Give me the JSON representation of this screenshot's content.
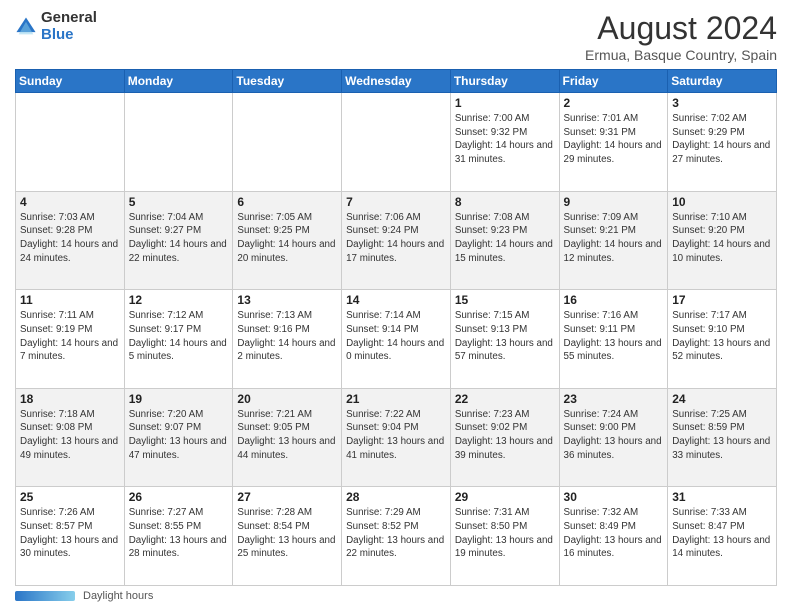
{
  "header": {
    "logo_general": "General",
    "logo_blue": "Blue",
    "month_year": "August 2024",
    "location": "Ermua, Basque Country, Spain"
  },
  "days_of_week": [
    "Sunday",
    "Monday",
    "Tuesday",
    "Wednesday",
    "Thursday",
    "Friday",
    "Saturday"
  ],
  "weeks": [
    [
      {
        "day": "",
        "info": ""
      },
      {
        "day": "",
        "info": ""
      },
      {
        "day": "",
        "info": ""
      },
      {
        "day": "",
        "info": ""
      },
      {
        "day": "1",
        "info": "Sunrise: 7:00 AM\nSunset: 9:32 PM\nDaylight: 14 hours and 31 minutes."
      },
      {
        "day": "2",
        "info": "Sunrise: 7:01 AM\nSunset: 9:31 PM\nDaylight: 14 hours and 29 minutes."
      },
      {
        "day": "3",
        "info": "Sunrise: 7:02 AM\nSunset: 9:29 PM\nDaylight: 14 hours and 27 minutes."
      }
    ],
    [
      {
        "day": "4",
        "info": "Sunrise: 7:03 AM\nSunset: 9:28 PM\nDaylight: 14 hours and 24 minutes."
      },
      {
        "day": "5",
        "info": "Sunrise: 7:04 AM\nSunset: 9:27 PM\nDaylight: 14 hours and 22 minutes."
      },
      {
        "day": "6",
        "info": "Sunrise: 7:05 AM\nSunset: 9:25 PM\nDaylight: 14 hours and 20 minutes."
      },
      {
        "day": "7",
        "info": "Sunrise: 7:06 AM\nSunset: 9:24 PM\nDaylight: 14 hours and 17 minutes."
      },
      {
        "day": "8",
        "info": "Sunrise: 7:08 AM\nSunset: 9:23 PM\nDaylight: 14 hours and 15 minutes."
      },
      {
        "day": "9",
        "info": "Sunrise: 7:09 AM\nSunset: 9:21 PM\nDaylight: 14 hours and 12 minutes."
      },
      {
        "day": "10",
        "info": "Sunrise: 7:10 AM\nSunset: 9:20 PM\nDaylight: 14 hours and 10 minutes."
      }
    ],
    [
      {
        "day": "11",
        "info": "Sunrise: 7:11 AM\nSunset: 9:19 PM\nDaylight: 14 hours and 7 minutes."
      },
      {
        "day": "12",
        "info": "Sunrise: 7:12 AM\nSunset: 9:17 PM\nDaylight: 14 hours and 5 minutes."
      },
      {
        "day": "13",
        "info": "Sunrise: 7:13 AM\nSunset: 9:16 PM\nDaylight: 14 hours and 2 minutes."
      },
      {
        "day": "14",
        "info": "Sunrise: 7:14 AM\nSunset: 9:14 PM\nDaylight: 14 hours and 0 minutes."
      },
      {
        "day": "15",
        "info": "Sunrise: 7:15 AM\nSunset: 9:13 PM\nDaylight: 13 hours and 57 minutes."
      },
      {
        "day": "16",
        "info": "Sunrise: 7:16 AM\nSunset: 9:11 PM\nDaylight: 13 hours and 55 minutes."
      },
      {
        "day": "17",
        "info": "Sunrise: 7:17 AM\nSunset: 9:10 PM\nDaylight: 13 hours and 52 minutes."
      }
    ],
    [
      {
        "day": "18",
        "info": "Sunrise: 7:18 AM\nSunset: 9:08 PM\nDaylight: 13 hours and 49 minutes."
      },
      {
        "day": "19",
        "info": "Sunrise: 7:20 AM\nSunset: 9:07 PM\nDaylight: 13 hours and 47 minutes."
      },
      {
        "day": "20",
        "info": "Sunrise: 7:21 AM\nSunset: 9:05 PM\nDaylight: 13 hours and 44 minutes."
      },
      {
        "day": "21",
        "info": "Sunrise: 7:22 AM\nSunset: 9:04 PM\nDaylight: 13 hours and 41 minutes."
      },
      {
        "day": "22",
        "info": "Sunrise: 7:23 AM\nSunset: 9:02 PM\nDaylight: 13 hours and 39 minutes."
      },
      {
        "day": "23",
        "info": "Sunrise: 7:24 AM\nSunset: 9:00 PM\nDaylight: 13 hours and 36 minutes."
      },
      {
        "day": "24",
        "info": "Sunrise: 7:25 AM\nSunset: 8:59 PM\nDaylight: 13 hours and 33 minutes."
      }
    ],
    [
      {
        "day": "25",
        "info": "Sunrise: 7:26 AM\nSunset: 8:57 PM\nDaylight: 13 hours and 30 minutes."
      },
      {
        "day": "26",
        "info": "Sunrise: 7:27 AM\nSunset: 8:55 PM\nDaylight: 13 hours and 28 minutes."
      },
      {
        "day": "27",
        "info": "Sunrise: 7:28 AM\nSunset: 8:54 PM\nDaylight: 13 hours and 25 minutes."
      },
      {
        "day": "28",
        "info": "Sunrise: 7:29 AM\nSunset: 8:52 PM\nDaylight: 13 hours and 22 minutes."
      },
      {
        "day": "29",
        "info": "Sunrise: 7:31 AM\nSunset: 8:50 PM\nDaylight: 13 hours and 19 minutes."
      },
      {
        "day": "30",
        "info": "Sunrise: 7:32 AM\nSunset: 8:49 PM\nDaylight: 13 hours and 16 minutes."
      },
      {
        "day": "31",
        "info": "Sunrise: 7:33 AM\nSunset: 8:47 PM\nDaylight: 13 hours and 14 minutes."
      }
    ]
  ],
  "footer": {
    "daylight_label": "Daylight hours"
  }
}
